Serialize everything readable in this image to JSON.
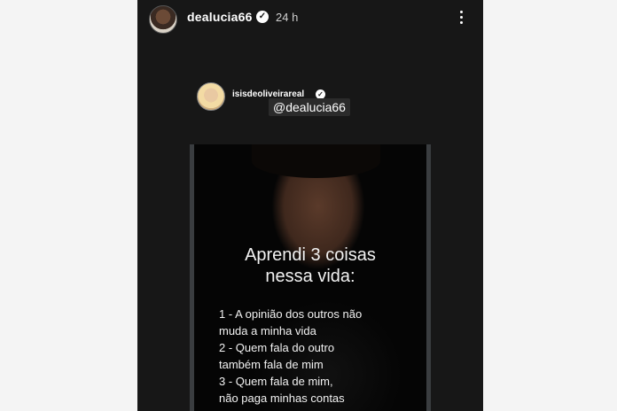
{
  "story": {
    "username": "dealucia66",
    "time": "24 h",
    "reshare": {
      "username": "isisdeoliveirareal",
      "mention": "@dealucia66"
    },
    "image_text": {
      "headline_1": "Aprendi 3 coisas",
      "headline_2": "nessa vida:",
      "lines": [
        "1 - A opinião dos outros não",
        "muda a minha vida",
        "2 - Quem fala do outro",
        "também fala de mim",
        "3 - Quem fala de mim,",
        "não paga minhas contas"
      ]
    }
  },
  "icons": {
    "verified": "verified-badge-icon",
    "more": "more-vertical-icon"
  },
  "colors": {
    "story_background": "#171717",
    "page_background": "#f4f4f4"
  }
}
